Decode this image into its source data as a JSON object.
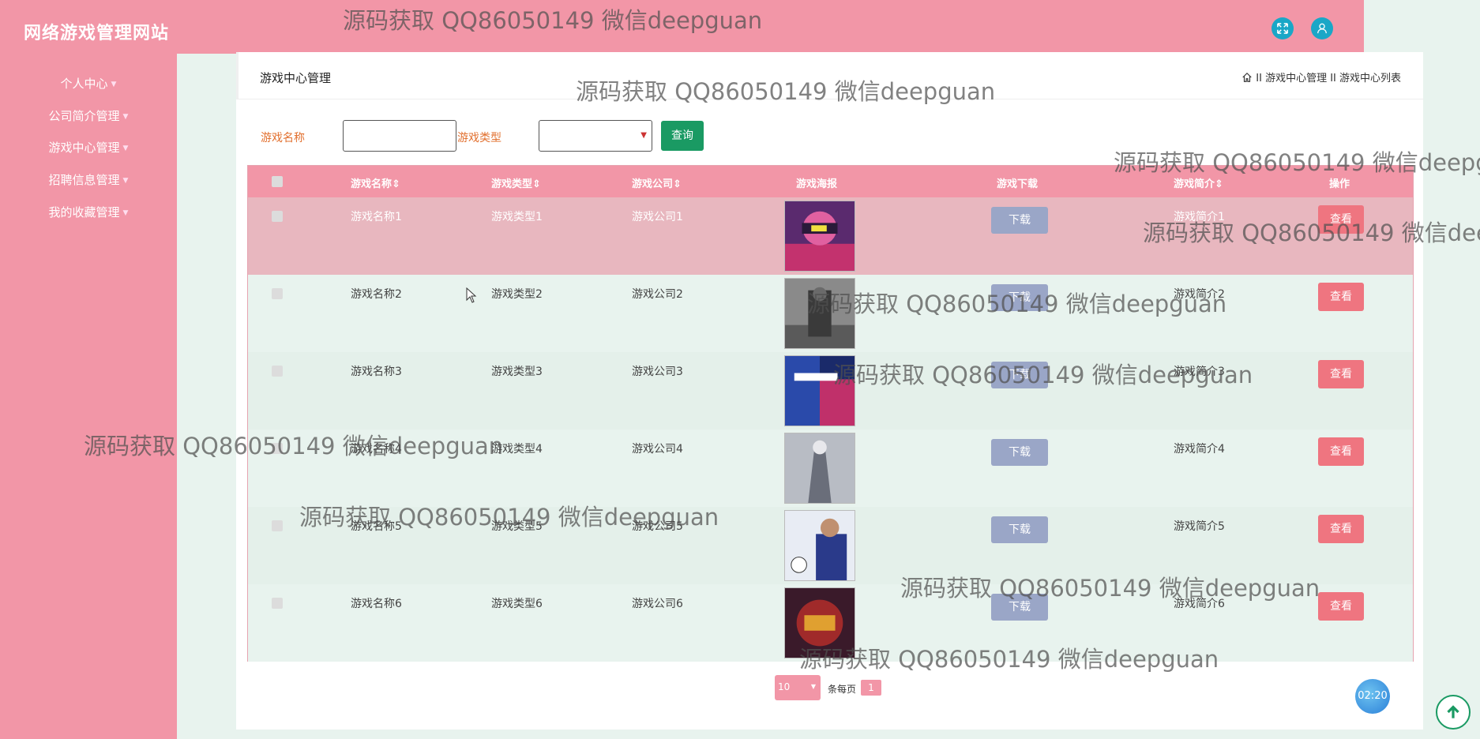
{
  "header": {
    "site_title": "网络游戏管理网站",
    "fullscreen_icon": "fullscreen-icon",
    "user_icon": "user-icon"
  },
  "sidebar": {
    "items": [
      {
        "label": "个人中心"
      },
      {
        "label": "公司简介管理"
      },
      {
        "label": "游戏中心管理"
      },
      {
        "label": "招聘信息管理"
      },
      {
        "label": "我的收藏管理"
      }
    ]
  },
  "panel": {
    "title": "游戏中心管理",
    "breadcrumb": {
      "home_icon": "home-icon",
      "text": "II 游戏中心管理 II 游戏中心列表"
    }
  },
  "search": {
    "name_label": "游戏名称",
    "name_value": "",
    "type_label": "游戏类型",
    "type_value": "",
    "query_label": "查询"
  },
  "table": {
    "columns": [
      "游戏名称",
      "游戏类型",
      "游戏公司",
      "游戏海报",
      "游戏下载",
      "游戏简介",
      "操作"
    ],
    "sort_marks": "⇕",
    "rows": [
      {
        "name": "游戏名称1",
        "type": "游戏类型1",
        "company": "游戏公司1",
        "download": "下载",
        "intro": "游戏简介1",
        "action": "查看"
      },
      {
        "name": "游戏名称2",
        "type": "游戏类型2",
        "company": "游戏公司2",
        "download": "下载",
        "intro": "游戏简介2",
        "action": "查看"
      },
      {
        "name": "游戏名称3",
        "type": "游戏类型3",
        "company": "游戏公司3",
        "download": "下载",
        "intro": "游戏简介3",
        "action": "查看"
      },
      {
        "name": "游戏名称4",
        "type": "游戏类型4",
        "company": "游戏公司4",
        "download": "下载",
        "intro": "游戏简介4",
        "action": "查看"
      },
      {
        "name": "游戏名称5",
        "type": "游戏类型5",
        "company": "游戏公司5",
        "download": "下载",
        "intro": "游戏简介5",
        "action": "查看"
      },
      {
        "name": "游戏名称6",
        "type": "游戏类型6",
        "company": "游戏公司6",
        "download": "下载",
        "intro": "游戏简介6",
        "action": "查看"
      }
    ]
  },
  "pagination": {
    "page_size": "10",
    "per_page_label": "条每页",
    "current_page": "1"
  },
  "timer": "02:20",
  "watermark": "源码获取 QQ86050149 微信deepguan",
  "colors": {
    "primary_pink": "#f296a7",
    "accent_green": "#1a9a63",
    "view_red": "#ef7580",
    "download_blue": "#9aa6c7"
  }
}
